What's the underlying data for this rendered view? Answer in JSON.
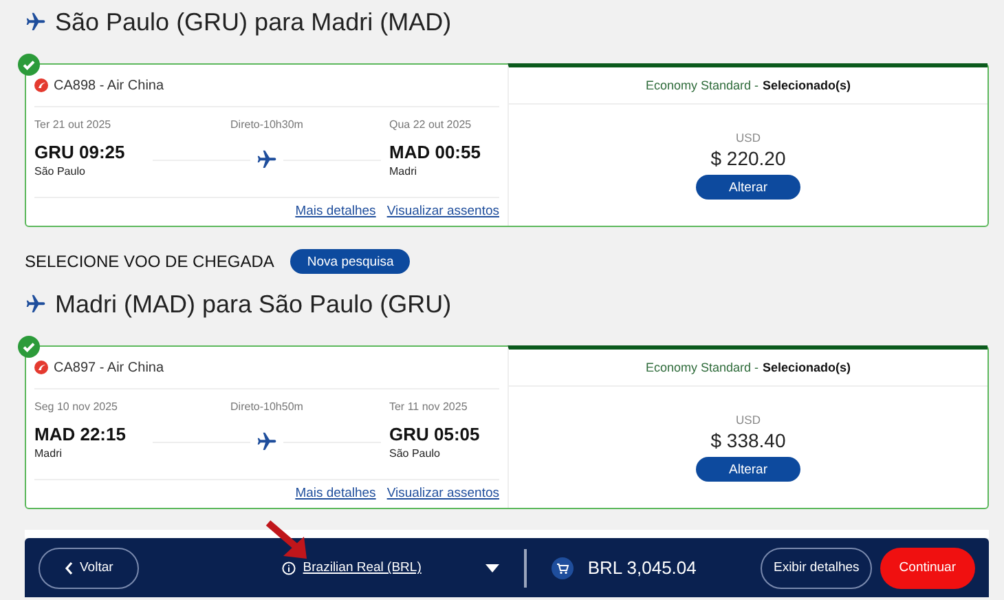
{
  "legs": [
    {
      "title": "São Paulo (GRU) para Madri (MAD)",
      "selected": true,
      "flight": "CA898 - Air China",
      "depart_date": "Ter 21 out 2025",
      "duration": "Direto-10h30m",
      "arrive_date": "Qua 22 out 2025",
      "depart_time": "GRU 09:25",
      "depart_city": "São Paulo",
      "arrive_time": "MAD 00:55",
      "arrive_city": "Madri",
      "links": [
        "Mais detalhes",
        "Visualizar assentos"
      ],
      "fare": "Economy Standard -",
      "fare_status": "Selecionado(s)",
      "currency": "USD",
      "price": "$ 220.20",
      "button": "Alterar"
    },
    {
      "title": "Madri (MAD) para São Paulo (GRU)",
      "selected": true,
      "flight": "CA897 - Air China",
      "depart_date": "Seg 10 nov 2025",
      "duration": "Direto-10h50m",
      "arrive_date": "Ter 11 nov 2025",
      "depart_time": "MAD 22:15",
      "depart_city": "Madri",
      "arrive_time": "GRU 05:05",
      "arrive_city": "São Paulo",
      "links": [
        "Mais detalhes",
        "Visualizar assentos"
      ],
      "fare": "Economy Standard -",
      "fare_status": "Selecionado(s)",
      "currency": "USD",
      "price": "$ 338.40",
      "button": "Alterar"
    }
  ],
  "return_header": {
    "label": "SELECIONE VOO DE CHEGADA",
    "button": "Nova pesquisa"
  },
  "footer": {
    "back": "Voltar",
    "currency": "Brazilian Real (BRL)",
    "total": "BRL 3,045.04",
    "details": "Exibir detalhes",
    "continue": "Continuar"
  }
}
